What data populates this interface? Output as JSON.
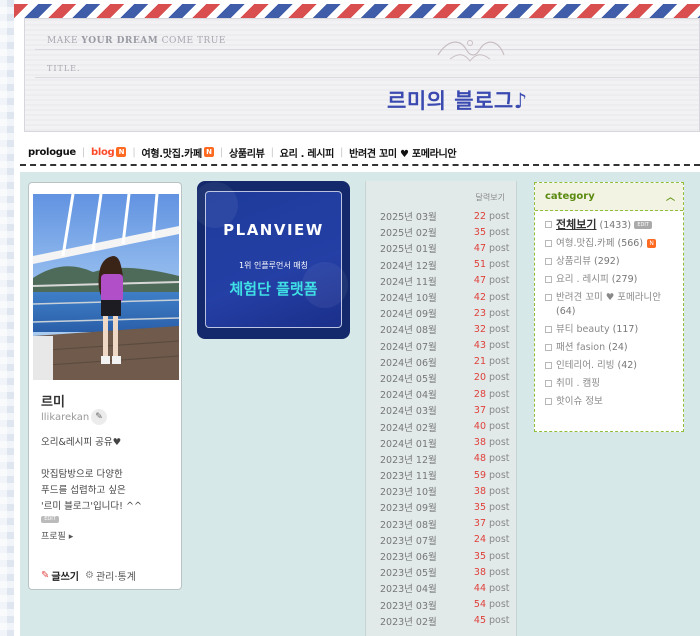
{
  "header": {
    "tagline_start": "MAKE ",
    "tagline_bold": "YOUR DREAM",
    "tagline_end": " COME TRUE",
    "title_tag": "TITLE.",
    "blog_title": "르미의 블로그♪"
  },
  "nav": {
    "items": [
      {
        "label": "prologue"
      },
      {
        "label": "blog",
        "badge": "N"
      },
      {
        "label": "여형.맛집.카페",
        "badge": "N"
      },
      {
        "label": "상품리뷰"
      },
      {
        "label": "요리 . 레시피"
      },
      {
        "label": "반려견 꼬미 ♥ 포메라니안"
      }
    ]
  },
  "profile": {
    "nickname": "르미",
    "user_id": "llikarekan",
    "bio": "오리&레시피 공유♥\n\n맛집탐방으로 다양한\n푸드를 섭렵하고 싶은\n'르미 블로그'입니다! ^^",
    "edit_tag": "EDIT",
    "prologue_link": "프로필 ▸",
    "write_label": "글쓰기",
    "manage_label": "관리·통계"
  },
  "ad": {
    "logo": "PLANVIEW",
    "sub": "1위 인플루언서 매칭",
    "main": "체험단 플랫폼"
  },
  "archive": {
    "header": "달력보기",
    "unit": "post",
    "months": [
      {
        "month": "2025년 03월",
        "count": "22"
      },
      {
        "month": "2025년 02월",
        "count": "35"
      },
      {
        "month": "2025년 01월",
        "count": "47"
      },
      {
        "month": "2024년 12월",
        "count": "51"
      },
      {
        "month": "2024년 11월",
        "count": "47"
      },
      {
        "month": "2024년 10월",
        "count": "42"
      },
      {
        "month": "2024년 09월",
        "count": "23"
      },
      {
        "month": "2024년 08월",
        "count": "32"
      },
      {
        "month": "2024년 07월",
        "count": "43"
      },
      {
        "month": "2024년 06월",
        "count": "21"
      },
      {
        "month": "2024년 05월",
        "count": "20"
      },
      {
        "month": "2024년 04월",
        "count": "28"
      },
      {
        "month": "2024년 03월",
        "count": "37"
      },
      {
        "month": "2024년 02월",
        "count": "40"
      },
      {
        "month": "2024년 01월",
        "count": "38"
      },
      {
        "month": "2023년 12월",
        "count": "48"
      },
      {
        "month": "2023년 11월",
        "count": "59"
      },
      {
        "month": "2023년 10월",
        "count": "38"
      },
      {
        "month": "2023년 09월",
        "count": "35"
      },
      {
        "month": "2023년 08월",
        "count": "37"
      },
      {
        "month": "2023년 07월",
        "count": "24"
      },
      {
        "month": "2023년 06월",
        "count": "35"
      },
      {
        "month": "2023년 05월",
        "count": "38"
      },
      {
        "month": "2023년 04월",
        "count": "44"
      },
      {
        "month": "2023년 03월",
        "count": "54"
      },
      {
        "month": "2023년 02월",
        "count": "45"
      }
    ]
  },
  "category": {
    "title": "category",
    "edit_tag": "EDIT",
    "items": [
      {
        "label": "전체보기",
        "count": "(1433)",
        "all": true
      },
      {
        "label": "여형.맛집.카페",
        "count": "(566)",
        "badge": "N"
      },
      {
        "label": "상품리뷰",
        "count": "(292)"
      },
      {
        "label": "요리 . 레시피",
        "count": "(279)"
      },
      {
        "label": "반려견 꼬미 ♥ 포메라니안",
        "count": "(64)"
      },
      {
        "label": "뷰티 beauty",
        "count": "(117)"
      },
      {
        "label": "패션 fasion",
        "count": "(24)"
      },
      {
        "label": "인테리어. 리빙",
        "count": "(42)"
      },
      {
        "label": "취미 . 캠핑",
        "count": ""
      },
      {
        "label": "핫이슈 정보",
        "count": ""
      }
    ]
  },
  "colors": {
    "accent_red": "#e0403a",
    "title_blue": "#3a4ab0",
    "category_green": "#5a8a10",
    "content_bg": "#d6e8e8"
  }
}
